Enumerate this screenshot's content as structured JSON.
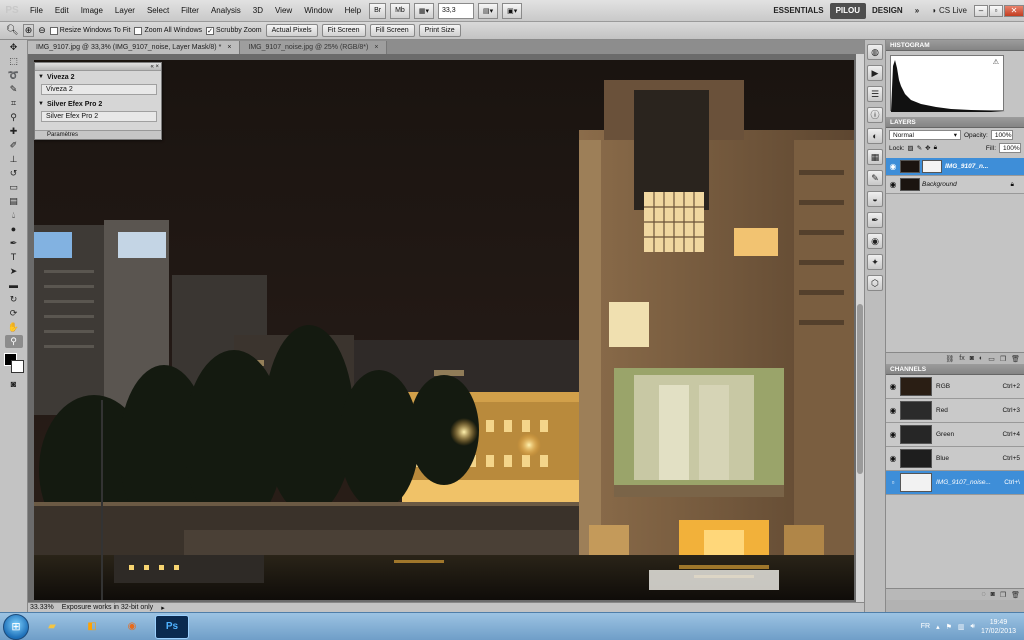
{
  "app": {
    "logo": "PS"
  },
  "menu": [
    "File",
    "Edit",
    "Image",
    "Layer",
    "Select",
    "Filter",
    "Analysis",
    "3D",
    "View",
    "Window",
    "Help"
  ],
  "topbar": {
    "bridge": "Br",
    "mini_bridge": "Mb",
    "zoom": "33,3",
    "workspaces": [
      "ESSENTIALS",
      "PILOU",
      "DESIGN"
    ],
    "active_workspace": "PILOU",
    "more": "»",
    "cs_live": "CS Live"
  },
  "options": {
    "resize_windows": "Resize Windows To Fit",
    "zoom_all": "Zoom All Windows",
    "scrubby": "Scrubby Zoom",
    "actual_pixels": "Actual Pixels",
    "fit_screen": "Fit Screen",
    "fill_screen": "Fill Screen",
    "print_size": "Print Size"
  },
  "tabs": [
    {
      "label": "IMG_9107.jpg @ 33,3% (IMG_9107_noise, Layer Mask/8) *",
      "active": true
    },
    {
      "label": "IMG_9107_noise.jpg @ 25% (RGB/8*)",
      "active": false
    }
  ],
  "plugin": {
    "section1": "Viveza 2",
    "button1": "Viveza 2",
    "section2": "Silver Efex Pro 2",
    "button2": "Silver Efex Pro 2",
    "footer": "Paramètres"
  },
  "status": {
    "zoom": "33.33%",
    "message": "Exposure works in 32-bit only"
  },
  "histogram": {
    "title": "HISTOGRAM"
  },
  "layers": {
    "title": "LAYERS",
    "blend_mode": "Normal",
    "opacity_label": "Opacity:",
    "opacity": "100%",
    "lock_label": "Lock:",
    "fill_label": "Fill:",
    "fill": "100%",
    "items": [
      {
        "name": "IMG_9107_n...",
        "active": true
      },
      {
        "name": "Background",
        "active": false
      }
    ]
  },
  "channels": {
    "title": "CHANNELS",
    "items": [
      {
        "name": "RGB",
        "key": "Ctrl+2"
      },
      {
        "name": "Red",
        "key": "Ctrl+3"
      },
      {
        "name": "Green",
        "key": "Ctrl+4"
      },
      {
        "name": "Blue",
        "key": "Ctrl+5"
      },
      {
        "name": "IMG_9107_noise...",
        "key": "Ctrl+\\"
      }
    ]
  },
  "taskbar": {
    "lang": "FR",
    "time": "19:49",
    "date": "17/02/2013"
  },
  "colors": {
    "accent": "#3e8ed8",
    "photo_bg": "#1b1410"
  }
}
